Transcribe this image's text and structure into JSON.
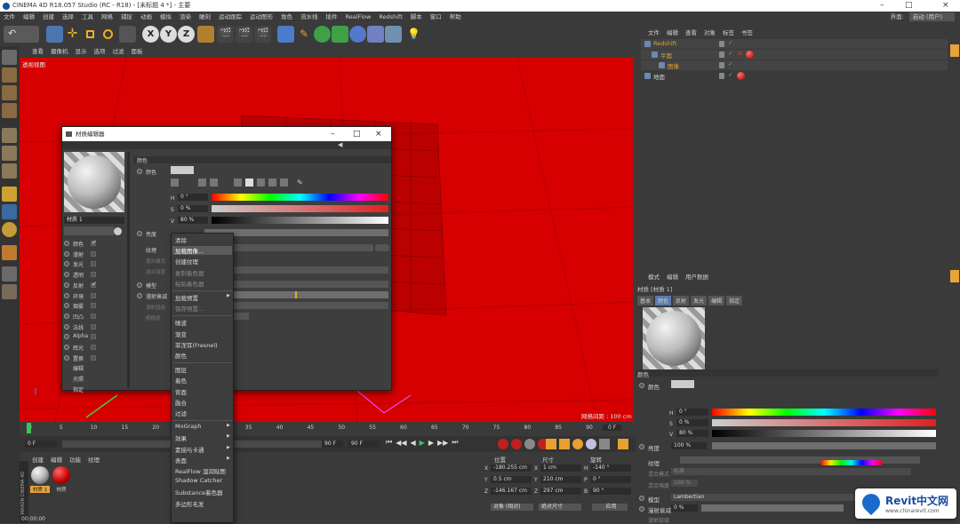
{
  "window": {
    "title": "CINEMA 4D R18.057 Studio (RC - R18) - [未标题 4 *] - 主要"
  },
  "menu": [
    "文件",
    "编辑",
    "创建",
    "选择",
    "工具",
    "网格",
    "捕捉",
    "动画",
    "模拟",
    "渲染",
    "雕刻",
    "运动跟踪",
    "运动图形",
    "角色",
    "流水线",
    "插件",
    "RealFlow",
    "Redshift",
    "脚本",
    "窗口",
    "帮助"
  ],
  "menu_right": {
    "layout_label": "界面:",
    "layout_value": "启动 (用户)"
  },
  "viewport": {
    "menu": [
      "查看",
      "摄像机",
      "显示",
      "选项",
      "过滤",
      "面板"
    ],
    "label": "透视视图",
    "grid_info": "网格间距 : 100 cm"
  },
  "timeline": {
    "ticks": [
      "0",
      "5",
      "10",
      "15",
      "20",
      "25",
      "30",
      "35",
      "40",
      "45",
      "50",
      "55",
      "60",
      "65",
      "70",
      "75",
      "80",
      "85",
      "90"
    ],
    "end_frame": "0 F"
  },
  "transport": {
    "start": "0 F",
    "current": "0 F",
    "end_a": "90 F",
    "end_b": "90 F"
  },
  "material_manager": {
    "menu": [
      "创建",
      "编辑",
      "功能",
      "纹理"
    ],
    "materials": [
      "材质 1",
      "材质"
    ],
    "logo": "MAXON CINEMA 4D",
    "status": "00:00:00"
  },
  "coordinates": {
    "headers": [
      "位置",
      "尺寸",
      "旋转"
    ],
    "rows": [
      {
        "axis": "X",
        "pos": "-180.255 cm",
        "size_axis": "X",
        "size": "1 cm",
        "rot_axis": "H",
        "rot": "-140 °"
      },
      {
        "axis": "Y",
        "pos": "0.5 cm",
        "size_axis": "Y",
        "size": "210 cm",
        "rot_axis": "P",
        "rot": "0 °"
      },
      {
        "axis": "Z",
        "pos": "-146.167 cm",
        "size_axis": "Z",
        "size": "297 cm",
        "rot_axis": "B",
        "rot": "90 °"
      }
    ],
    "mode_a": "对象 (相对)",
    "mode_b": "绝对尺寸",
    "apply": "应用"
  },
  "object_manager": {
    "menu": [
      "文件",
      "编辑",
      "查看",
      "对象",
      "标签",
      "书签"
    ],
    "objects": [
      {
        "name": "Redshift",
        "level": 0,
        "color": "#d8a23a"
      },
      {
        "name": "平面",
        "level": 1,
        "color": "#d8a23a"
      },
      {
        "name": "图像",
        "level": 2,
        "color": "#d8a23a"
      },
      {
        "name": "地面",
        "level": 0,
        "color": "#cfcfcf"
      }
    ]
  },
  "attributes": {
    "menu": [
      "模式",
      "编辑",
      "用户数据"
    ],
    "material_title": "材质 [材质 1]",
    "tabs": [
      "基本",
      "颜色",
      "反射",
      "发光",
      "编辑",
      "指定"
    ],
    "section": "颜色",
    "color_label": "颜色",
    "h_label": "H",
    "h_value": "0 °",
    "s_label": "S",
    "s_value": "0 %",
    "v_label": "V",
    "v_value": "80 %",
    "brightness_label": "亮度",
    "brightness_value": "100 %",
    "texture_label": "纹理",
    "mix_mode_label": "混合模式",
    "mix_mode_value": "标准",
    "mix_strength_label": "混合强度",
    "mix_strength_value": "100 %",
    "model_label": "模型",
    "model_value": "Lambertian",
    "diffuse_label": "漫射衰减",
    "diffuse_value": "0 %",
    "diffuse_level_label": "漫射层级"
  },
  "material_editor": {
    "title": "材质编辑器",
    "mat_name": "材质 1",
    "section": "颜色",
    "color_label": "颜色",
    "h_label": "H",
    "h_value": "0 °",
    "s_label": "S",
    "s_value": "0 %",
    "v_label": "V",
    "v_value": "80 %",
    "brightness_label": "亮度",
    "texture_label": "纹理",
    "mix_mode_label": "混合模式",
    "mix_strength_label": "混合强度",
    "model_label": "模型",
    "diffuse_label": "漫射衰减",
    "diffuse_level_label": "漫射层级",
    "roughness_label": "粗糙度",
    "channels": [
      {
        "label": "颜色",
        "checked": true
      },
      {
        "label": "漫射",
        "checked": false
      },
      {
        "label": "发光",
        "checked": false
      },
      {
        "label": "透明",
        "checked": false
      },
      {
        "label": "反射",
        "checked": true
      },
      {
        "label": "环境",
        "checked": false
      },
      {
        "label": "烟雾",
        "checked": false
      },
      {
        "label": "凹凸",
        "checked": false
      },
      {
        "label": "法线",
        "checked": false
      },
      {
        "label": "Alpha",
        "checked": false
      },
      {
        "label": "辉光",
        "checked": false
      },
      {
        "label": "置换",
        "checked": false
      },
      {
        "label": "编辑",
        "checked": null
      },
      {
        "label": "光照",
        "checked": null
      },
      {
        "label": "指定",
        "checked": null
      }
    ]
  },
  "context_menu": {
    "items": [
      {
        "label": "清除",
        "disabled": false
      },
      {
        "label": "加载图像...",
        "disabled": false,
        "selected": true
      },
      {
        "label": "创建纹理",
        "disabled": false
      },
      {
        "label": "复制着色器",
        "disabled": true
      },
      {
        "label": "粘贴着色器",
        "disabled": true
      },
      {
        "sep": true
      },
      {
        "label": "加载预置",
        "disabled": false,
        "sub": true
      },
      {
        "label": "保存预置...",
        "disabled": true
      },
      {
        "sep": true
      },
      {
        "label": "噪波",
        "disabled": false
      },
      {
        "label": "渐变",
        "disabled": false
      },
      {
        "label": "菲涅耳(Fresnel)",
        "disabled": false
      },
      {
        "label": "颜色",
        "disabled": false
      },
      {
        "sep": true
      },
      {
        "label": "图层",
        "disabled": false
      },
      {
        "label": "着色",
        "disabled": false
      },
      {
        "label": "背面",
        "disabled": false
      },
      {
        "label": "融合",
        "disabled": false
      },
      {
        "label": "过滤",
        "disabled": false
      },
      {
        "sep": true
      },
      {
        "label": "MoGraph",
        "disabled": false,
        "sub": true
      },
      {
        "label": "效果",
        "disabled": false,
        "sub": true
      },
      {
        "label": "素描与卡通",
        "disabled": false,
        "sub": true
      },
      {
        "label": "表面",
        "disabled": false,
        "sub": true
      },
      {
        "label": "RealFlow 湿润贴图",
        "disabled": false
      },
      {
        "label": "Shadow Catcher",
        "disabled": false
      },
      {
        "label": "Substance着色器",
        "disabled": false
      },
      {
        "label": "多边形毛发",
        "disabled": false
      }
    ]
  },
  "watermark": {
    "brand": "Revit中文网",
    "url": "www.chinarevit.com"
  },
  "colors": {
    "viewport_red": "#d60000",
    "ui_bg": "#3c3c3c",
    "accent_orange": "#e8a33a"
  }
}
